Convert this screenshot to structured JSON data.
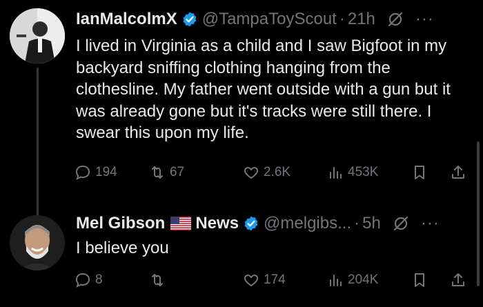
{
  "tweets": [
    {
      "display_name": "IanMalcolmX",
      "handle": "@TampaToyScout",
      "separator": "·",
      "time": "21h",
      "more_label": "···",
      "text": "I lived in Virginia as a child and I saw Bigfoot in my backyard sniffing clothing hanging from the clothesline. My father went outside with a gun but it was already gone but it's tracks were still there. I swear this upon my life.",
      "counts": {
        "replies": "194",
        "retweets": "67",
        "likes": "2.6K",
        "views": "453K"
      }
    },
    {
      "display_name": "Mel Gibson",
      "name_suffix": "News",
      "flag": "us-flag",
      "handle": "@melgibs...",
      "separator": "·",
      "time": "5h",
      "more_label": "···",
      "text": "I believe you",
      "counts": {
        "replies": "8",
        "retweets": "",
        "likes": "174",
        "views": "204K"
      }
    }
  ],
  "icons": {
    "verified": "verified-badge-icon",
    "grok": "grok-icon",
    "reply": "reply-icon",
    "retweet": "retweet-icon",
    "like": "heart-icon",
    "views": "views-icon",
    "bookmark": "bookmark-icon",
    "share": "share-icon"
  },
  "colors": {
    "background": "#000000",
    "text": "#e7e9ea",
    "muted": "#71767b",
    "verified": "#1d9bf0"
  }
}
